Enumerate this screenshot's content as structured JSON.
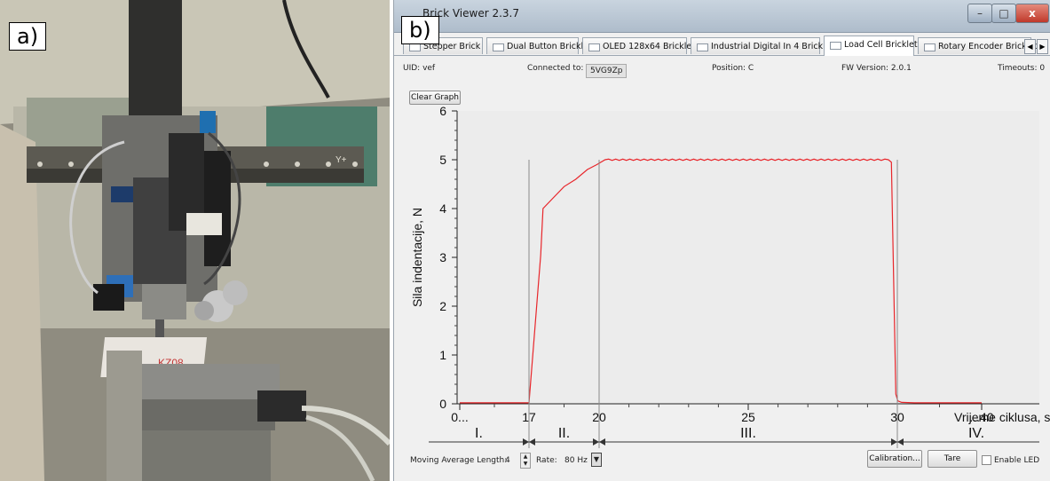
{
  "photo": {
    "label": "a)",
    "sample_marking": "KZ08",
    "axis_marking": "Y+"
  },
  "window": {
    "panel_label": "b)",
    "title": "Brick Viewer 2.3.7",
    "controls": {
      "minimize": "–",
      "maximize": "□",
      "close": "x"
    }
  },
  "tabs": [
    {
      "label": "Stepper Brick"
    },
    {
      "label": "Dual Button Bricklet"
    },
    {
      "label": "OLED 128x64 Bricklet"
    },
    {
      "label": "Industrial Digital In 4 Bricklet"
    },
    {
      "label": "Load Cell Bricklet",
      "active": true
    },
    {
      "label": "Rotary Encoder Bricklet"
    }
  ],
  "tab_nav": {
    "prev": "◀",
    "next": "▶"
  },
  "info": {
    "uid_label": "UID: vef",
    "connected_label": "Connected to:",
    "connected_value": "5VG9Zp",
    "position": "Position: C",
    "fw_version": "FW Version: 2.0.1",
    "timeouts": "Timeouts: 0"
  },
  "buttons": {
    "clear_graph": "Clear Graph",
    "calibration": "Calibration...",
    "tare": "Tare",
    "enable_led": "Enable LED"
  },
  "controls": {
    "moving_average_label": "Moving Average Length:",
    "moving_average_value": "4",
    "rate_label": "Rate:",
    "rate_value": "80 Hz"
  },
  "chart_data": {
    "type": "line",
    "ylabel": "Sila indentacije, N",
    "xlabel": "Vrijeme ciklusa, s",
    "ylim": [
      0,
      6
    ],
    "y_ticks": [
      "0",
      "1",
      "2",
      "3",
      "4",
      "5",
      "6"
    ],
    "x_tick_labels": [
      "0...",
      "17",
      "20",
      "25",
      "30",
      "...40"
    ],
    "phases": [
      "I.",
      "II.",
      "III.",
      "IV."
    ],
    "line_color": "#e8262b",
    "grid": false,
    "series": [
      {
        "x": [
          0,
          17,
          17.5,
          17.6,
          18.0,
          18.5,
          19.0,
          19.5,
          19.9,
          20.2,
          29.7,
          29.8,
          29.95,
          30.05,
          30.5,
          32,
          40
        ],
        "y": [
          0.02,
          0.02,
          3.05,
          4.0,
          4.2,
          4.45,
          4.6,
          4.8,
          4.9,
          5.0,
          5.0,
          4.95,
          0.2,
          0.06,
          0.03,
          0.02,
          0.02
        ]
      }
    ]
  }
}
